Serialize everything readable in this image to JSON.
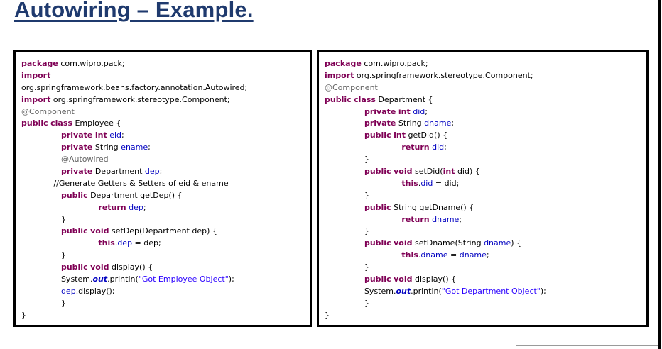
{
  "slide": {
    "title": "Autowiring – Example."
  },
  "colors": {
    "title": "#1f3a6e",
    "keyword": "#7f0055",
    "annotation": "#646464",
    "field": "#0000c0",
    "string": "#2a00ff"
  },
  "left_code": {
    "lines": [
      [
        {
          "t": "package",
          "c": "kw"
        },
        {
          "t": " com.wipro.pack;"
        }
      ],
      [
        {
          "t": "import",
          "c": "kw"
        }
      ],
      [
        {
          "t": "org.springframework.beans.factory.annotation.Autowired;"
        }
      ],
      [
        {
          "t": "import",
          "c": "kw"
        },
        {
          "t": " org.springframework.stereotype.Component;"
        }
      ],
      [
        {
          "t": "@Component",
          "c": "ann"
        }
      ],
      [
        {
          "t": "public",
          "c": "kw"
        },
        {
          "t": " "
        },
        {
          "t": "class",
          "c": "kw"
        },
        {
          "t": " Employee {"
        }
      ],
      [
        {
          "t": "                "
        },
        {
          "t": "private",
          "c": "kw"
        },
        {
          "t": " "
        },
        {
          "t": "int",
          "c": "kw"
        },
        {
          "t": " "
        },
        {
          "t": "eid",
          "c": "fld"
        },
        {
          "t": ";"
        }
      ],
      [
        {
          "t": "                "
        },
        {
          "t": "private",
          "c": "kw"
        },
        {
          "t": " String "
        },
        {
          "t": "ename",
          "c": "fld"
        },
        {
          "t": ";"
        }
      ],
      [
        {
          "t": "                "
        },
        {
          "t": "@Autowired",
          "c": "ann"
        }
      ],
      [
        {
          "t": "                "
        },
        {
          "t": "private",
          "c": "kw"
        },
        {
          "t": " Department "
        },
        {
          "t": "dep",
          "c": "fld"
        },
        {
          "t": ";"
        }
      ],
      [
        {
          "t": "             //Generate Getters & Setters of eid & ename"
        }
      ],
      [
        {
          "t": "                "
        },
        {
          "t": "public",
          "c": "kw"
        },
        {
          "t": " Department getDep() {"
        }
      ],
      [
        {
          "t": "                               "
        },
        {
          "t": "return",
          "c": "kw"
        },
        {
          "t": " "
        },
        {
          "t": "dep",
          "c": "fld"
        },
        {
          "t": ";"
        }
      ],
      [
        {
          "t": "                }"
        }
      ],
      [
        {
          "t": "                "
        },
        {
          "t": "public",
          "c": "kw"
        },
        {
          "t": " "
        },
        {
          "t": "void",
          "c": "kw"
        },
        {
          "t": " setDep(Department dep) {"
        }
      ],
      [
        {
          "t": "                               "
        },
        {
          "t": "this",
          "c": "kw"
        },
        {
          "t": "."
        },
        {
          "t": "dep",
          "c": "fld"
        },
        {
          "t": " = dep;"
        }
      ],
      [
        {
          "t": "                }"
        }
      ],
      [
        {
          "t": "                "
        },
        {
          "t": "public",
          "c": "kw"
        },
        {
          "t": " "
        },
        {
          "t": "void",
          "c": "kw"
        },
        {
          "t": " display() {"
        }
      ],
      [
        {
          "t": "                System."
        },
        {
          "t": "out",
          "c": "sfld"
        },
        {
          "t": ".println("
        },
        {
          "t": "\"Got Employee Object\"",
          "c": "str"
        },
        {
          "t": ");"
        }
      ],
      [
        {
          "t": "                "
        },
        {
          "t": "dep",
          "c": "fld"
        },
        {
          "t": ".display();"
        }
      ],
      [
        {
          "t": "                }"
        }
      ],
      [
        {
          "t": "}"
        }
      ]
    ]
  },
  "right_code": {
    "lines": [
      [
        {
          "t": "package",
          "c": "kw"
        },
        {
          "t": " com.wipro.pack;"
        }
      ],
      [
        {
          "t": "import",
          "c": "kw"
        },
        {
          "t": " org.springframework.stereotype.Component;"
        }
      ],
      [
        {
          "t": "@Component",
          "c": "ann"
        }
      ],
      [
        {
          "t": "public",
          "c": "kw"
        },
        {
          "t": " "
        },
        {
          "t": "class",
          "c": "kw"
        },
        {
          "t": " Department {"
        }
      ],
      [
        {
          "t": "                "
        },
        {
          "t": "private",
          "c": "kw"
        },
        {
          "t": " "
        },
        {
          "t": "int",
          "c": "kw"
        },
        {
          "t": " "
        },
        {
          "t": "did",
          "c": "fld"
        },
        {
          "t": ";"
        }
      ],
      [
        {
          "t": "                "
        },
        {
          "t": "private",
          "c": "kw"
        },
        {
          "t": " String "
        },
        {
          "t": "dname",
          "c": "fld"
        },
        {
          "t": ";"
        }
      ],
      [
        {
          "t": "                "
        },
        {
          "t": "public",
          "c": "kw"
        },
        {
          "t": " "
        },
        {
          "t": "int",
          "c": "kw"
        },
        {
          "t": " getDid() {"
        }
      ],
      [
        {
          "t": "                               "
        },
        {
          "t": "return",
          "c": "kw"
        },
        {
          "t": " "
        },
        {
          "t": "did",
          "c": "fld"
        },
        {
          "t": ";"
        }
      ],
      [
        {
          "t": "                }"
        }
      ],
      [
        {
          "t": "                "
        },
        {
          "t": "public",
          "c": "kw"
        },
        {
          "t": " "
        },
        {
          "t": "void",
          "c": "kw"
        },
        {
          "t": " setDid("
        },
        {
          "t": "int",
          "c": "kw"
        },
        {
          "t": " did) {"
        }
      ],
      [
        {
          "t": "                               "
        },
        {
          "t": "this",
          "c": "kw"
        },
        {
          "t": "."
        },
        {
          "t": "did",
          "c": "fld"
        },
        {
          "t": " = did;"
        }
      ],
      [
        {
          "t": "                }"
        }
      ],
      [
        {
          "t": "                "
        },
        {
          "t": "public",
          "c": "kw"
        },
        {
          "t": " String getDname() {"
        }
      ],
      [
        {
          "t": "                               "
        },
        {
          "t": "return",
          "c": "kw"
        },
        {
          "t": " "
        },
        {
          "t": "dname",
          "c": "fld"
        },
        {
          "t": ";"
        }
      ],
      [
        {
          "t": "                }"
        }
      ],
      [
        {
          "t": "                "
        },
        {
          "t": "public",
          "c": "kw"
        },
        {
          "t": " "
        },
        {
          "t": "void",
          "c": "kw"
        },
        {
          "t": " setDname(String "
        },
        {
          "t": "dname",
          "c": "fld"
        },
        {
          "t": ") {"
        }
      ],
      [
        {
          "t": "                               "
        },
        {
          "t": "this",
          "c": "kw"
        },
        {
          "t": "."
        },
        {
          "t": "dname",
          "c": "fld"
        },
        {
          "t": " = "
        },
        {
          "t": "dname",
          "c": "fld"
        },
        {
          "t": ";"
        }
      ],
      [
        {
          "t": "                }"
        }
      ],
      [
        {
          "t": "                "
        },
        {
          "t": "public",
          "c": "kw"
        },
        {
          "t": " "
        },
        {
          "t": "void",
          "c": "kw"
        },
        {
          "t": " display() {"
        }
      ],
      [
        {
          "t": "                System."
        },
        {
          "t": "out",
          "c": "sfld"
        },
        {
          "t": ".println("
        },
        {
          "t": "\"Got Department Object\"",
          "c": "str"
        },
        {
          "t": ");"
        }
      ],
      [
        {
          "t": "                }"
        }
      ],
      [
        {
          "t": "}"
        }
      ]
    ]
  }
}
